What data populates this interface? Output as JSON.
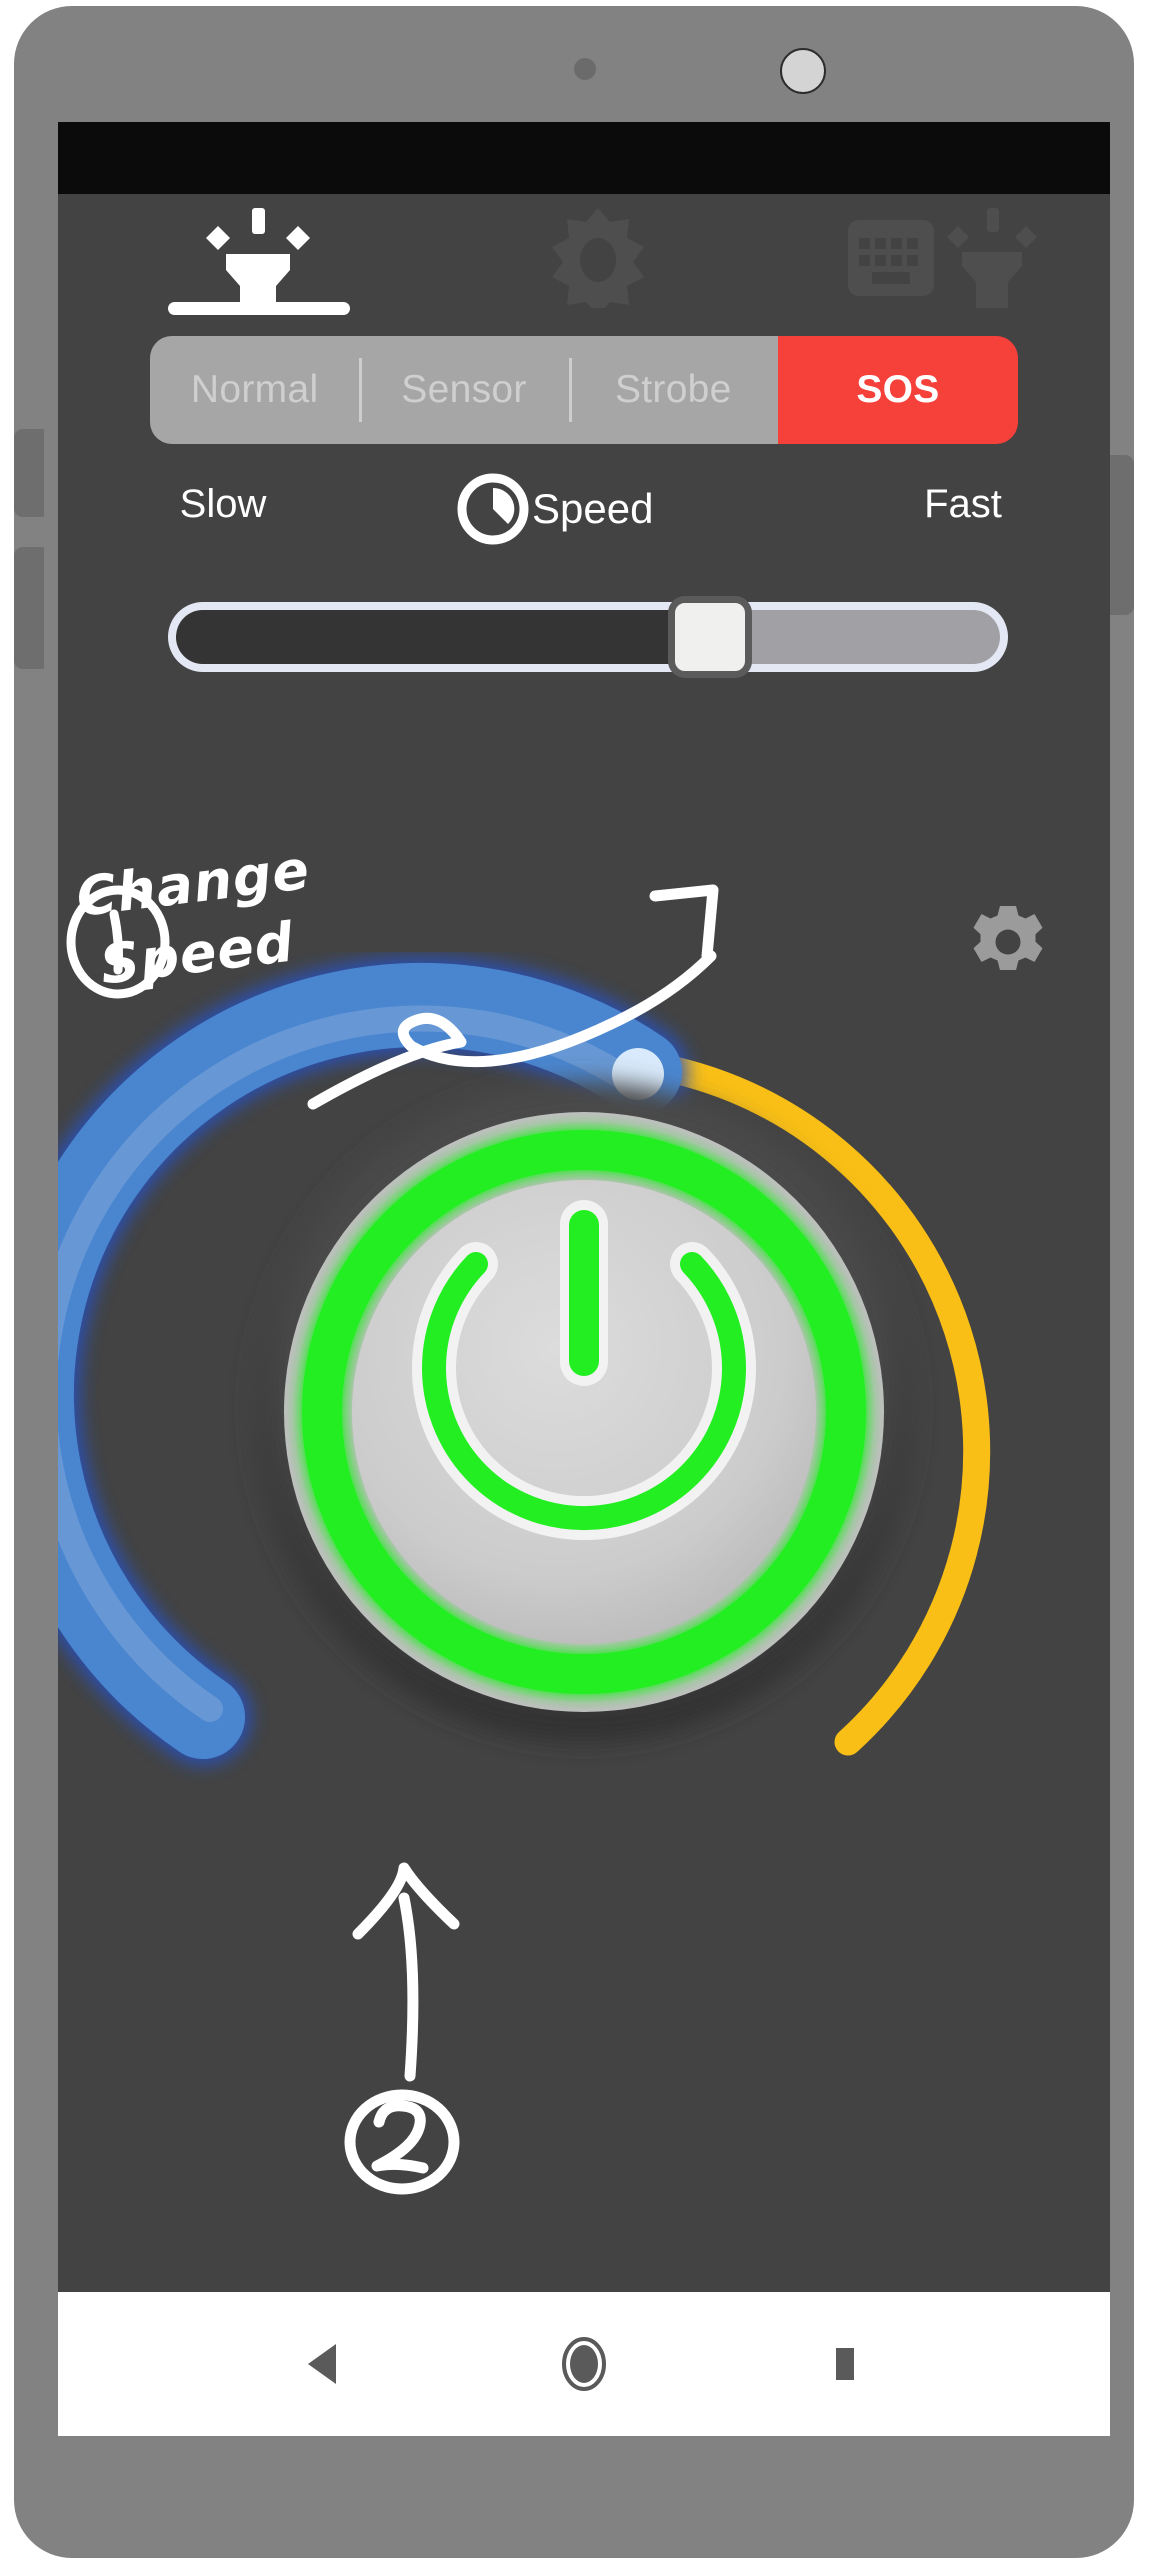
{
  "device": {
    "frame_color": "#828282",
    "screen_bg": "#434343",
    "status_bar_color": "#0b0b0b",
    "sensor": "proximity-sensor",
    "camera": "front-camera",
    "side_buttons": [
      "volume-up",
      "volume-down",
      "power"
    ]
  },
  "toolbar": {
    "tabs": [
      {
        "id": "flashlight",
        "icon": "flashlight-icon",
        "active": true
      },
      {
        "id": "brightness",
        "icon": "sun-brightness-icon",
        "active": false
      },
      {
        "id": "screen-light",
        "icon": "keyboard-screen-icon",
        "active": false
      },
      {
        "id": "flashlight-alt",
        "icon": "flashlight-icon",
        "active": false
      }
    ]
  },
  "modes": {
    "options": [
      "Normal",
      "Sensor",
      "Strobe",
      "SOS"
    ],
    "selected": "SOS",
    "inactive_bg": "#a6a6a6",
    "inactive_text": "#cfcfcf",
    "active_bg": "#f6403a",
    "active_text": "#ffffff"
  },
  "speed": {
    "icon": "speed-clock-icon",
    "label": "Speed",
    "min_label": "Slow",
    "max_label": "Fast",
    "value_percent": 62,
    "track_filled_color": "#343434",
    "track_remaining_color": "#a0a0a5",
    "thumb_color": "#f0f0ee"
  },
  "settings": {
    "icon": "gear-icon"
  },
  "power_dial": {
    "power_icon": "power-icon",
    "button_state": "on",
    "ring_color": "#22ee22",
    "face_color": "#cfcfcf",
    "brightness_arc": {
      "icon": "brightness-arc-slider",
      "color": "#4a86d0",
      "handle": "arc-handle-dot",
      "handle_color": "#d8eafc"
    },
    "secondary_arc": {
      "color": "#f9bf16"
    }
  },
  "annotations": [
    {
      "id": "1",
      "marker": "1",
      "line1": "Change",
      "line2": "Speed",
      "arrow": "curved-arrow-to-slider"
    },
    {
      "id": "2",
      "marker": "2",
      "arrow": "straight-arrow-to-power-button"
    }
  ],
  "nav_bar": {
    "background": "#ffffff",
    "buttons": [
      {
        "id": "back",
        "icon": "back-triangle-icon"
      },
      {
        "id": "home",
        "icon": "home-circle-icon"
      },
      {
        "id": "recents",
        "icon": "recents-square-icon"
      }
    ]
  }
}
